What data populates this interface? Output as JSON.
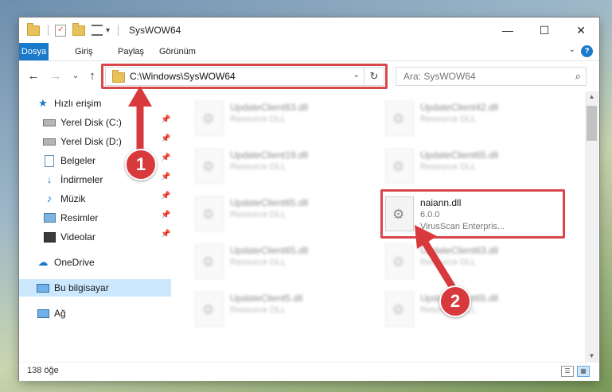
{
  "window": {
    "title": "SysWOW64",
    "qa_arrow": "▾",
    "minimize": "—",
    "maximize": "☐",
    "close": "✕"
  },
  "ribbon": {
    "tabs": [
      "Dosya",
      "Giriş",
      "Paylaş",
      "Görünüm"
    ],
    "help": "?",
    "collapse": "⌄"
  },
  "nav": {
    "back": "←",
    "forward": "→",
    "recent": "⌄",
    "up": "↑",
    "address": "C:\\Windows\\SysWOW64",
    "address_drop": "⌄",
    "refresh": "↻",
    "search_placeholder": "Ara: SysWOW64",
    "search_icon": "⌕"
  },
  "sidebar": {
    "quick_access": "Hızlı erişim",
    "items": [
      {
        "label": "Yerel Disk (C:)",
        "icon": "drive-icon"
      },
      {
        "label": "Yerel Disk (D:)",
        "icon": "drive-icon"
      },
      {
        "label": "Belgeler",
        "icon": "documents-icon"
      },
      {
        "label": "İndirmeler",
        "icon": "download-icon"
      },
      {
        "label": "Müzik",
        "icon": "music-icon"
      },
      {
        "label": "Resimler",
        "icon": "pictures-icon"
      },
      {
        "label": "Videolar",
        "icon": "videos-icon"
      }
    ],
    "onedrive": "OneDrive",
    "this_pc": "Bu bilgisayar",
    "network": "Ağ",
    "pin_glyph": "📌"
  },
  "files": [
    {
      "name": "UpdateClient63.dll",
      "type": "Resource DLL"
    },
    {
      "name": "UpdateClient42.dll",
      "type": "Resource DLL"
    },
    {
      "name": "UpdateClient19.dll",
      "type": "Resource DLL"
    },
    {
      "name": "UpdateClient65.dll",
      "type": "Resource DLL"
    },
    {
      "name": "UpdateClient65.dll",
      "type": "Resource DLL"
    },
    {
      "name": "naiann.dll",
      "version": "6.0.0",
      "company": "VirusScan Enterpris..."
    },
    {
      "name": "UpdateClient65.dll",
      "type": "Resource DLL"
    },
    {
      "name": "UpdateClient63.dll",
      "type": "Resource DLL"
    },
    {
      "name": "UpdateClient5.dll",
      "type": "Resource DLL"
    },
    {
      "name": "UpdateClient65.dll",
      "type": "Resource DLL"
    }
  ],
  "status": {
    "count": "138 öğe"
  },
  "callouts": {
    "one": "1",
    "two": "2"
  },
  "colors": {
    "accent": "#1979ca",
    "highlight": "#d9474b",
    "selection": "#cce8ff"
  }
}
